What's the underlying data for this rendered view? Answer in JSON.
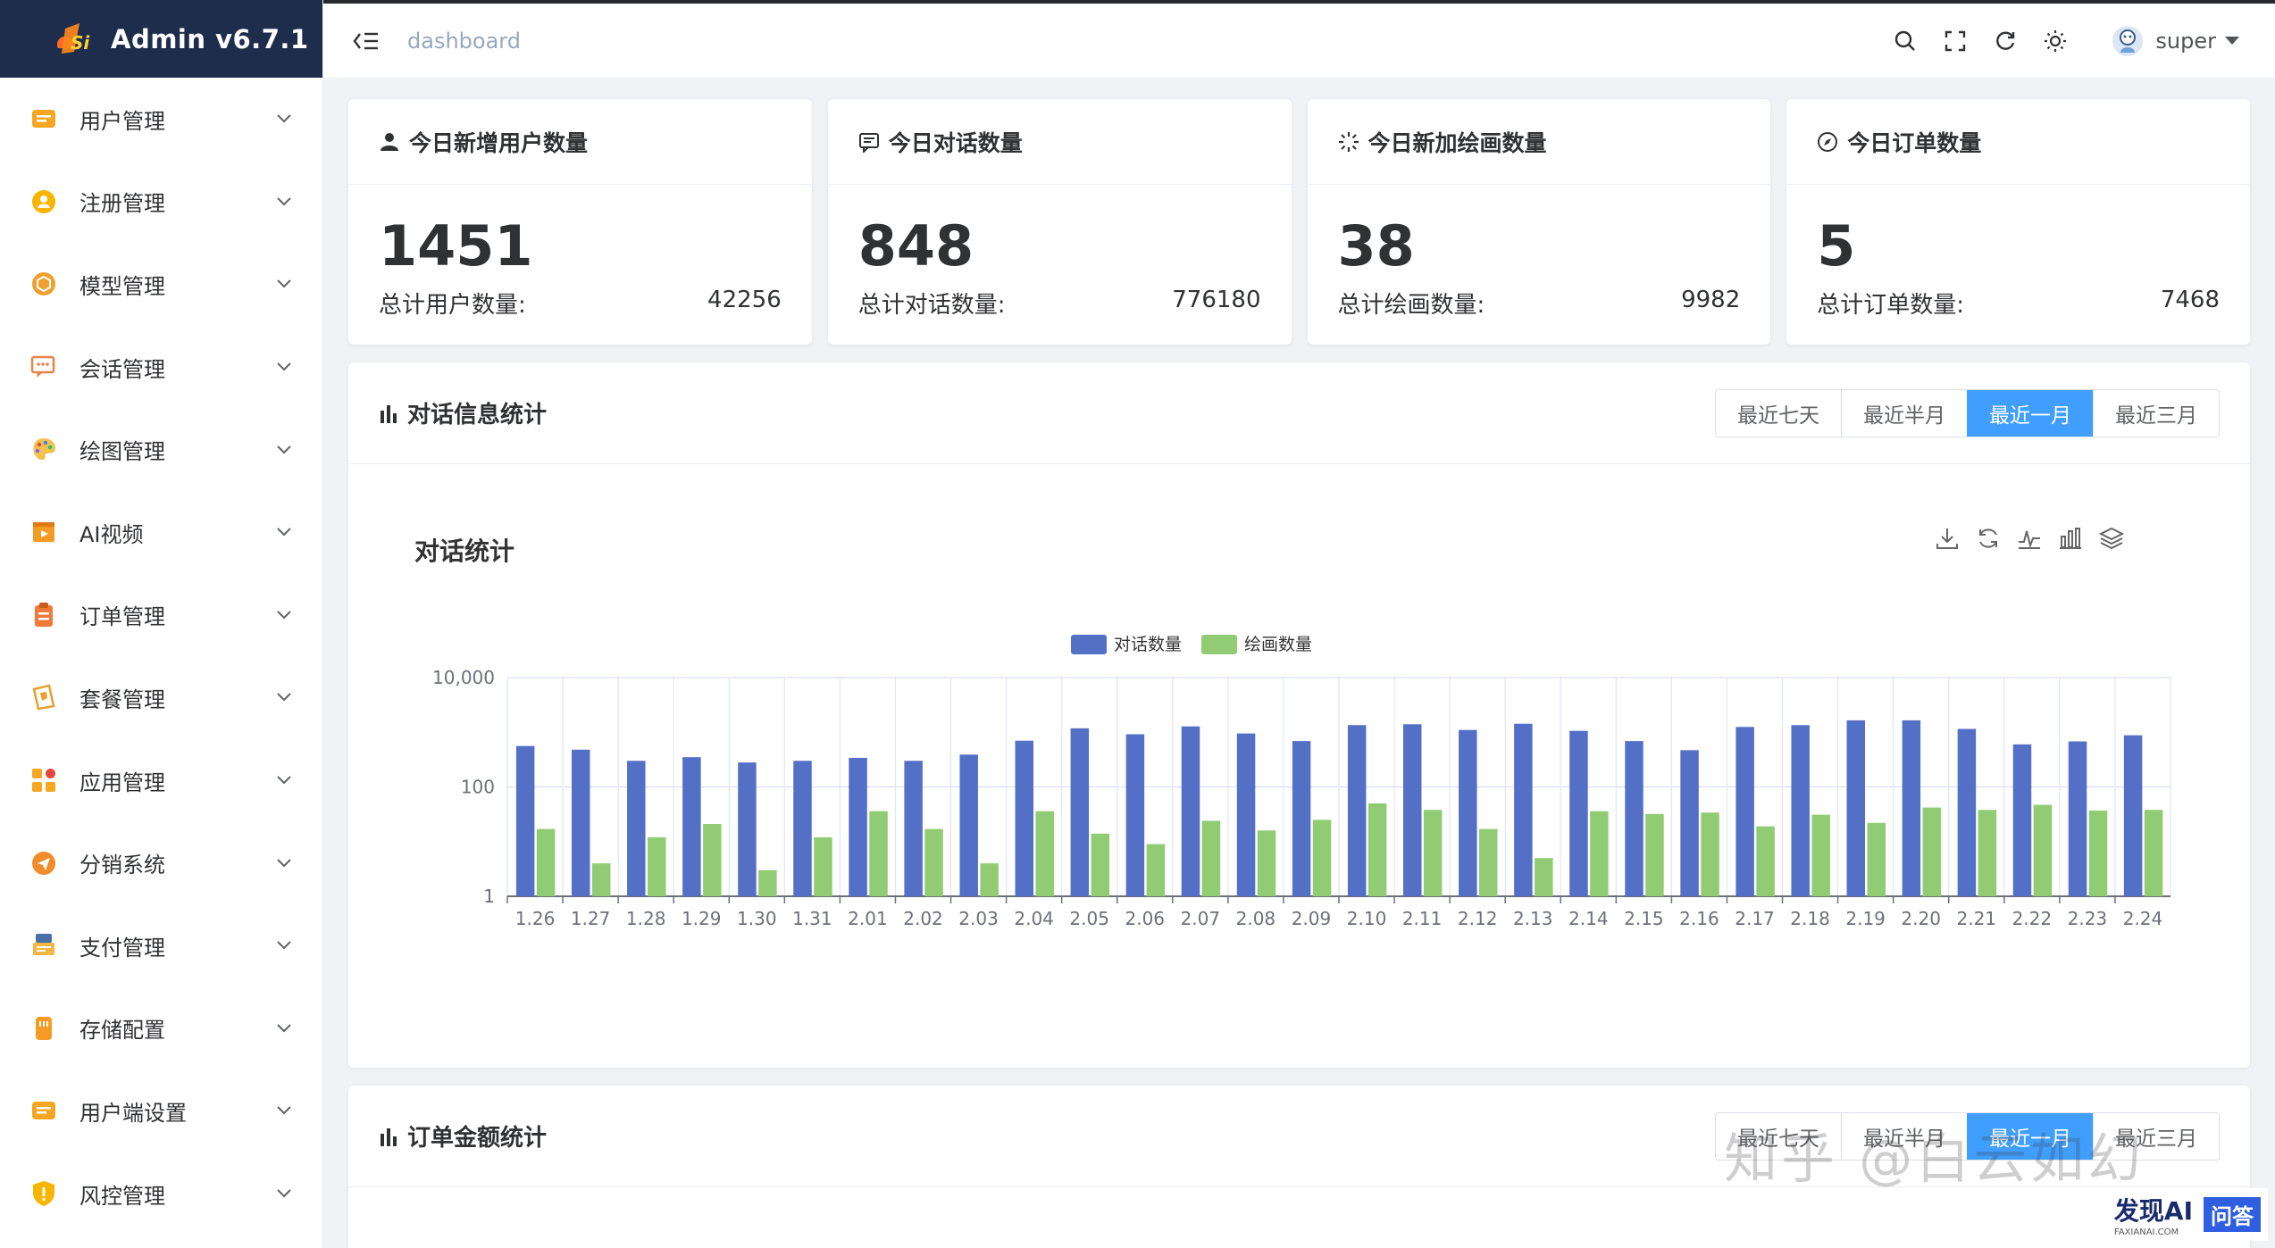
{
  "app": {
    "title": "Admin v6.7.1"
  },
  "sidebar": {
    "items": [
      {
        "label": "用户管理",
        "icon": "user-card-icon",
        "color": "#f5a623"
      },
      {
        "label": "注册管理",
        "icon": "user-circle-icon",
        "color": "#f7b500"
      },
      {
        "label": "模型管理",
        "icon": "cube-icon",
        "color": "#f0a030"
      },
      {
        "label": "会话管理",
        "icon": "chat-bubble-icon",
        "color": "#e8834a"
      },
      {
        "label": "绘图管理",
        "icon": "palette-icon",
        "color": "#f2c14e"
      },
      {
        "label": "AI视频",
        "icon": "video-icon",
        "color": "#f59a23"
      },
      {
        "label": "订单管理",
        "icon": "clipboard-icon",
        "color": "#f07a3a"
      },
      {
        "label": "套餐管理",
        "icon": "package-icon",
        "color": "#e8a030"
      },
      {
        "label": "应用管理",
        "icon": "apps-grid-icon",
        "color": "#f5a623"
      },
      {
        "label": "分销系统",
        "icon": "send-icon",
        "color": "#f08c2a"
      },
      {
        "label": "支付管理",
        "icon": "pos-terminal-icon",
        "color": "#f5b642"
      },
      {
        "label": "存储配置",
        "icon": "storage-icon",
        "color": "#f59a23"
      },
      {
        "label": "用户端设置",
        "icon": "settings-card-icon",
        "color": "#f5a623"
      },
      {
        "label": "风控管理",
        "icon": "shield-icon",
        "color": "#f7b500"
      }
    ]
  },
  "header": {
    "breadcrumb": "dashboard",
    "username": "super"
  },
  "stats": [
    {
      "title": "今日新增用户数量",
      "icon": "user-icon",
      "value": "1451",
      "total_label": "总计用户数量:",
      "total_value": "42256"
    },
    {
      "title": "今日对话数量",
      "icon": "message-icon",
      "value": "848",
      "total_label": "总计对话数量:",
      "total_value": "776180"
    },
    {
      "title": "今日新加绘画数量",
      "icon": "loading-icon",
      "value": "38",
      "total_label": "总计绘画数量:",
      "total_value": "9982"
    },
    {
      "title": "今日订单数量",
      "icon": "compass-icon",
      "value": "5",
      "total_label": "总计订单数量:",
      "total_value": "7468"
    }
  ],
  "chat_panel": {
    "title": "对话信息统计",
    "ranges": [
      "最近七天",
      "最近半月",
      "最近一月",
      "最近三月"
    ],
    "active_range": 2
  },
  "order_panel": {
    "title": "订单金额统计",
    "ranges": [
      "最近七天",
      "最近半月",
      "最近一月",
      "最近三月"
    ],
    "active_range": 2
  },
  "watermark": "知乎 @白云如幻",
  "badge": {
    "logo": "发现AI",
    "sub": "FAXIANAI.COM",
    "button": "问答"
  },
  "colors": {
    "series_chat": "#5470c6",
    "series_draw": "#91cc75",
    "accent": "#409eff",
    "logo_bg": "#1f2d4d"
  },
  "chart_data": {
    "type": "bar",
    "title": "对话统计",
    "yscale": "log",
    "ylim": [
      1,
      10000
    ],
    "yticks": [
      "1",
      "100",
      "10,000"
    ],
    "categories": [
      "1.26",
      "1.27",
      "1.28",
      "1.29",
      "1.30",
      "1.31",
      "2.01",
      "2.02",
      "2.03",
      "2.04",
      "2.05",
      "2.06",
      "2.07",
      "2.08",
      "2.09",
      "2.10",
      "2.11",
      "2.12",
      "2.13",
      "2.14",
      "2.15",
      "2.16",
      "2.17",
      "2.18",
      "2.19",
      "2.20",
      "2.21",
      "2.22",
      "2.23",
      "2.24"
    ],
    "series": [
      {
        "name": "对话数量",
        "values": [
          560,
          480,
          300,
          350,
          280,
          300,
          340,
          300,
          390,
          700,
          1180,
          920,
          1280,
          950,
          690,
          1350,
          1400,
          1100,
          1430,
          1060,
          690,
          470,
          1250,
          1350,
          1650,
          1650,
          1150,
          600,
          680,
          880
        ]
      },
      {
        "name": "绘画数量",
        "values": [
          17,
          4,
          12,
          21,
          3,
          12,
          36,
          17,
          4,
          36,
          14,
          9,
          24,
          16,
          25,
          50,
          38,
          17,
          5,
          36,
          32,
          34,
          19,
          31,
          22,
          42,
          38,
          47,
          37,
          38
        ]
      }
    ],
    "legend_position": "top-center",
    "grid": true
  }
}
